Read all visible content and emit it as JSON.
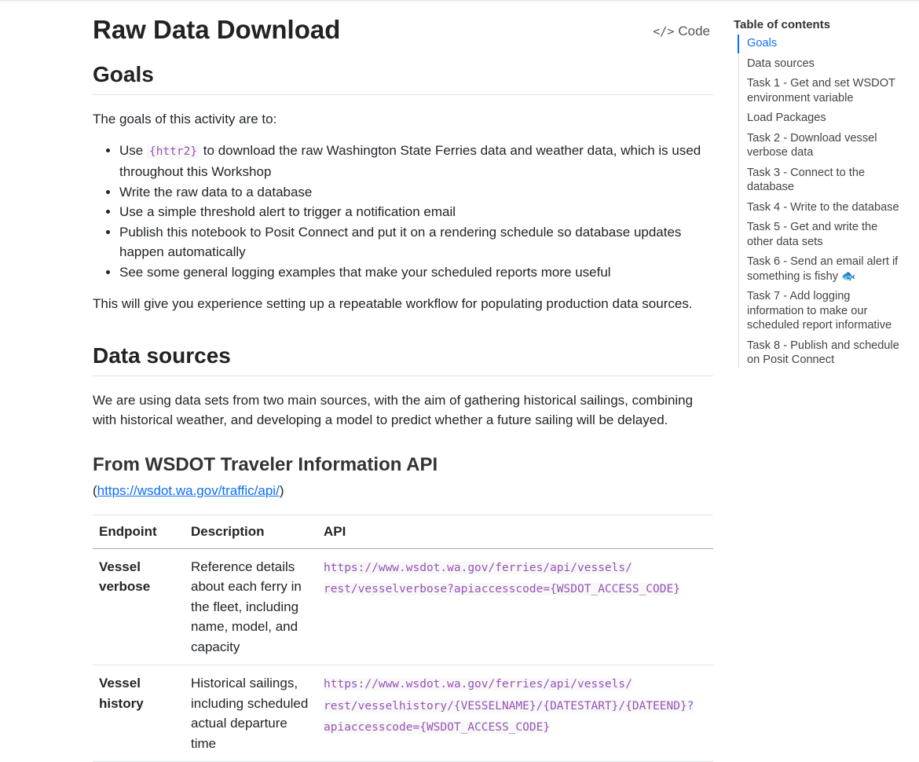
{
  "page": {
    "title": "Raw Data Download",
    "code_button_label": "Code",
    "code_icon": "</>"
  },
  "goals": {
    "heading": "Goals",
    "intro": "The goals of this activity are to:",
    "items": [
      {
        "pre": "Use ",
        "code": "{httr2}",
        "post": " to download the raw Washington State Ferries data and weather data, which is used throughout this Workshop"
      },
      {
        "text": "Write the raw data to a database"
      },
      {
        "text": "Use a simple threshold alert to trigger a notification email"
      },
      {
        "text": "Publish this notebook to Posit Connect and put it on a rendering schedule so database updates happen automatically"
      },
      {
        "text": "See some general logging examples that make your scheduled reports more useful"
      }
    ],
    "summary": "This will give you experience setting up a repeatable workflow for populating production data sources."
  },
  "data_sources": {
    "heading": "Data sources",
    "text": "We are using data sets from two main sources, with the aim of gathering historical sailings, combining with historical weather, and developing a model to predict whether a future sailing will be delayed.",
    "wsdot": {
      "heading": "From WSDOT Traveler Information API",
      "open_paren": "(",
      "link": "https://wsdot.wa.gov/traffic/api/",
      "close_paren": ")"
    },
    "table": {
      "headers": [
        "Endpoint",
        "Description",
        "API"
      ],
      "rows": [
        {
          "endpoint": "Vessel verbose",
          "description": "Reference details about each ferry in the fleet, including name, model, and capacity",
          "api_line1": "https://www.wsdot.wa.gov/ferries/api/vessels/",
          "api_line2": "rest/vesselverbose?apiaccesscode={WSDOT_ACCESS_CODE}",
          "api_line3": ""
        },
        {
          "endpoint": "Vessel history",
          "description": "Historical sailings, including scheduled actual departure time",
          "api_line1": "https://www.wsdot.wa.gov/ferries/api/vessels/",
          "api_line2": "rest/vesselhistory/{VESSELNAME}/{DATESTART}/{DATEEND}?",
          "api_line3": "apiaccesscode={WSDOT_ACCESS_CODE}"
        }
      ]
    }
  },
  "toc": {
    "title": "Table of contents",
    "items": [
      "Goals",
      "Data sources",
      "Task 1 - Get and set WSDOT environment variable",
      "Load Packages",
      "Task 2 - Download vessel verbose data",
      "Task 3 - Connect to the database",
      "Task 4 - Write to the database",
      "Task 5 - Get and write the other data sets",
      "Task 6 - Send an email alert if something is fishy 🐟",
      "Task 7 - Add logging information to make our scheduled report informative",
      "Task 8 - Publish and schedule on Posit Connect"
    ]
  }
}
